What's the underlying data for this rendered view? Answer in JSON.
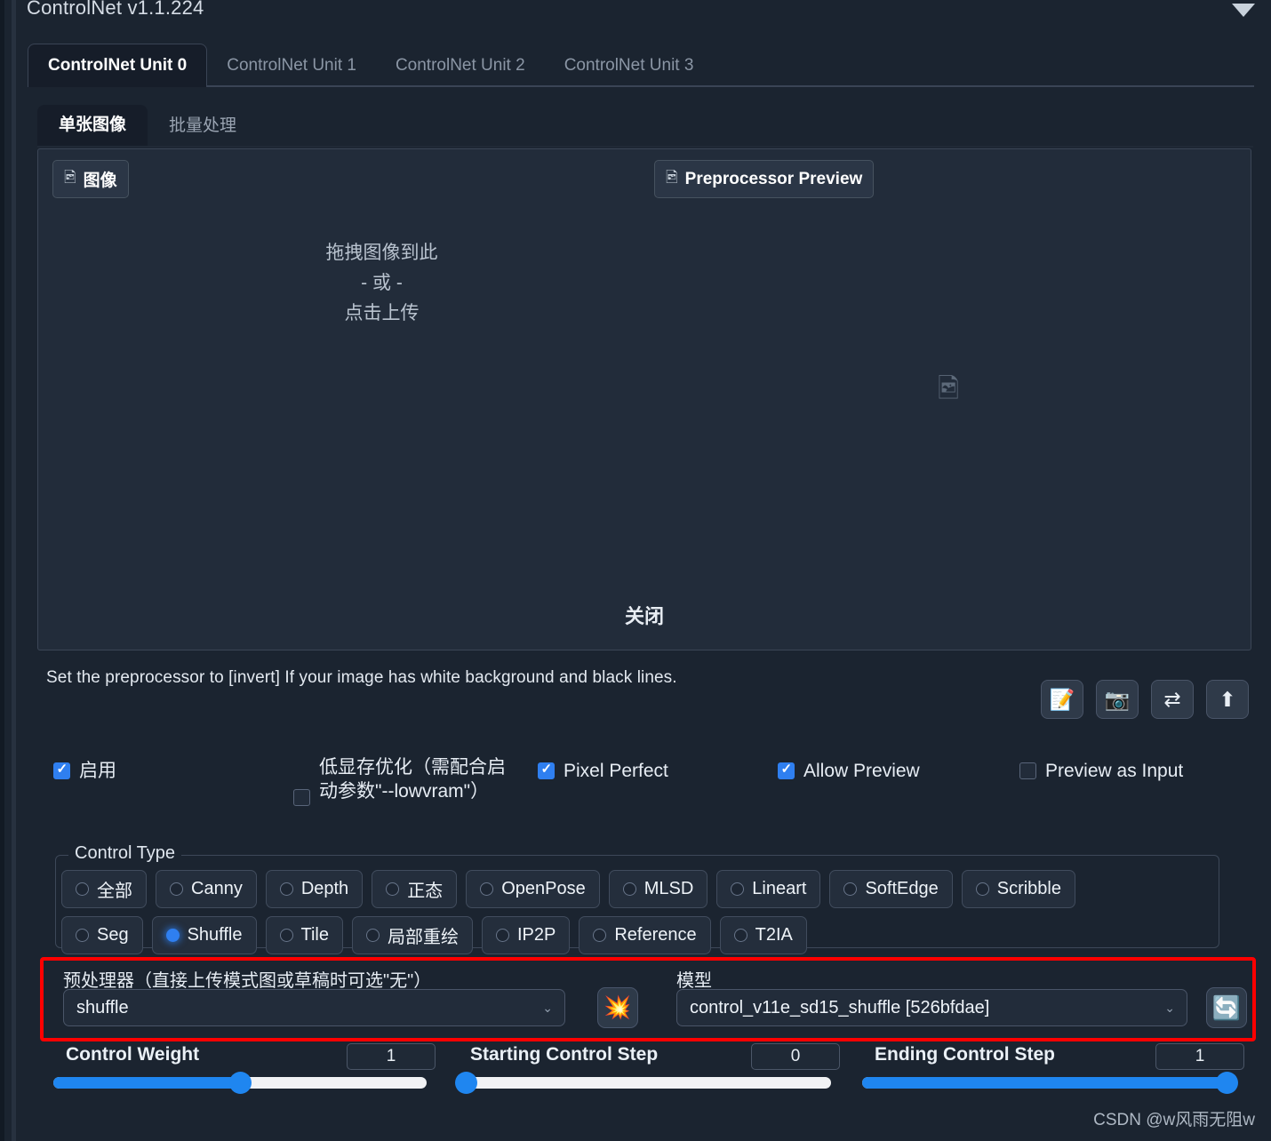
{
  "app": {
    "title": "ControlNet v1.1.224",
    "collapse_icon": "chevron-down-icon"
  },
  "unit_tabs": [
    {
      "label": "ControlNet Unit 0",
      "active": true
    },
    {
      "label": "ControlNet Unit 1",
      "active": false
    },
    {
      "label": "ControlNet Unit 2",
      "active": false
    },
    {
      "label": "ControlNet Unit 3",
      "active": false
    }
  ],
  "sub_tabs": [
    {
      "label": "单张图像",
      "active": true
    },
    {
      "label": "批量处理",
      "active": false
    }
  ],
  "image_panel": {
    "image_chip": {
      "icon": "image-icon",
      "label": "图像"
    },
    "preview_chip": {
      "icon": "image-icon",
      "label": "Preprocessor Preview"
    },
    "drop_line1": "拖拽图像到此",
    "drop_line2": "- 或 -",
    "drop_line3": "点击上传",
    "placeholder_icon": "image-placeholder-icon",
    "close_label": "关闭"
  },
  "info": {
    "text": "Set the preprocessor to [invert] If your image has white background and black lines.",
    "buttons": [
      {
        "name": "edit-note-icon",
        "glyph": "📝"
      },
      {
        "name": "camera-icon",
        "glyph": "📷"
      },
      {
        "name": "swap-arrows-icon",
        "glyph": "⇄"
      },
      {
        "name": "upload-arrow-icon",
        "glyph": "⬆"
      }
    ]
  },
  "checkboxes": [
    {
      "label": "启用",
      "checked": true
    },
    {
      "label": "低显存优化（需配合启动参数\"--lowvram\"）",
      "checked": false
    },
    {
      "label": "Pixel Perfect",
      "checked": true
    },
    {
      "label": "Allow Preview",
      "checked": true
    },
    {
      "label": "Preview as Input",
      "checked": false
    }
  ],
  "control_type": {
    "legend": "Control Type",
    "row1": [
      {
        "label": "全部",
        "selected": false
      },
      {
        "label": "Canny",
        "selected": false
      },
      {
        "label": "Depth",
        "selected": false
      },
      {
        "label": "正态",
        "selected": false
      },
      {
        "label": "OpenPose",
        "selected": false
      },
      {
        "label": "MLSD",
        "selected": false
      },
      {
        "label": "Lineart",
        "selected": false
      },
      {
        "label": "SoftEdge",
        "selected": false
      },
      {
        "label": "Scribble",
        "selected": false
      }
    ],
    "row2": [
      {
        "label": "Seg",
        "selected": false
      },
      {
        "label": "Shuffle",
        "selected": true
      },
      {
        "label": "Tile",
        "selected": false
      },
      {
        "label": "局部重绘",
        "selected": false
      },
      {
        "label": "IP2P",
        "selected": false
      },
      {
        "label": "Reference",
        "selected": false
      },
      {
        "label": "T2IA",
        "selected": false
      }
    ]
  },
  "model_row": {
    "highlight_color": "#ff0000",
    "preprocessor_label": "预处理器（直接上传模式图或草稿时可选\"无\"）",
    "preprocessor_value": "shuffle",
    "run_button_icon": "explosion-icon",
    "run_button_glyph": "💥",
    "model_label": "模型",
    "model_value": "control_v11e_sd15_shuffle [526bfdae]",
    "refresh_button_icon": "refresh-icon",
    "refresh_button_glyph": "🔄",
    "chevron": "⌄"
  },
  "sliders": [
    {
      "name": "Control Weight",
      "value": "1",
      "percent": 50
    },
    {
      "name": "Starting Control Step",
      "value": "0",
      "percent": 0
    },
    {
      "name": "Ending Control Step",
      "value": "1",
      "percent": 100
    }
  ],
  "watermark": "CSDN @w风雨无阻w",
  "colors": {
    "accent_blue": "#1f86f0",
    "highlight_red": "#ff0000",
    "panel_bg": "#222c3a",
    "page_bg": "#1b2430"
  }
}
